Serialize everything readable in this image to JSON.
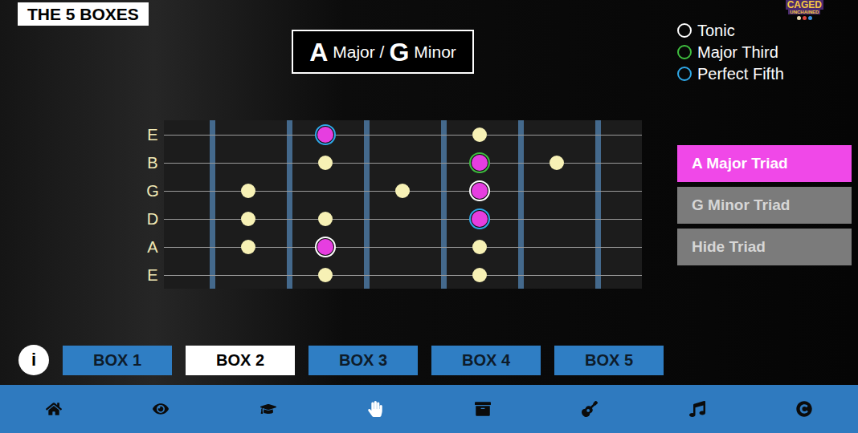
{
  "header": {
    "title": "THE 5 BOXES"
  },
  "logo": {
    "lines": [
      "CAGED",
      "UNCHAINED"
    ],
    "dots": [
      {
        "color": "#e8d9b0"
      },
      {
        "color": "#d9443f"
      },
      {
        "color": "#3d8fe0"
      }
    ]
  },
  "key_title": [
    {
      "text": "A",
      "big": true
    },
    {
      "text": "Major /",
      "big": false
    },
    {
      "text": "G",
      "big": true
    },
    {
      "text": "Minor",
      "big": false
    }
  ],
  "legend": [
    {
      "label": "Tonic",
      "interval": "tonic",
      "color": "#ffffff"
    },
    {
      "label": "Major Third",
      "interval": "third",
      "color": "#3fbf3f"
    },
    {
      "label": "Perfect Fifth",
      "interval": "fifth",
      "color": "#2fa8e8"
    }
  ],
  "fretboard": {
    "strings": [
      {
        "label": "E",
        "dots": [
          {
            "position": 1,
            "in_triad": true,
            "interval": "fifth"
          },
          {
            "position": 3,
            "in_triad": false,
            "interval": "none"
          }
        ]
      },
      {
        "label": "B",
        "dots": [
          {
            "position": 1,
            "in_triad": false,
            "interval": "none"
          },
          {
            "position": 3,
            "in_triad": true,
            "interval": "third"
          },
          {
            "position": 4,
            "in_triad": false,
            "interval": "none"
          }
        ]
      },
      {
        "label": "G",
        "dots": [
          {
            "position": 0,
            "in_triad": false,
            "interval": "none"
          },
          {
            "position": 2,
            "in_triad": false,
            "interval": "none"
          },
          {
            "position": 3,
            "in_triad": true,
            "interval": "tonic"
          }
        ]
      },
      {
        "label": "D",
        "dots": [
          {
            "position": 0,
            "in_triad": false,
            "interval": "none"
          },
          {
            "position": 1,
            "in_triad": false,
            "interval": "none"
          },
          {
            "position": 3,
            "in_triad": true,
            "interval": "fifth"
          }
        ]
      },
      {
        "label": "A",
        "dots": [
          {
            "position": 0,
            "in_triad": false,
            "interval": "none"
          },
          {
            "position": 1,
            "in_triad": true,
            "interval": "tonic"
          },
          {
            "position": 3,
            "in_triad": false,
            "interval": "none"
          }
        ]
      },
      {
        "label": "E",
        "dots": [
          {
            "position": 1,
            "in_triad": false,
            "interval": "none"
          },
          {
            "position": 3,
            "in_triad": false,
            "interval": "none"
          }
        ]
      }
    ]
  },
  "triad_buttons": [
    {
      "label": "A Major Triad",
      "selected": true
    },
    {
      "label": "G Minor Triad",
      "selected": false
    },
    {
      "label": "Hide Triad",
      "selected": false
    }
  ],
  "info": "i",
  "boxes": [
    {
      "label": "BOX 1",
      "selected": false
    },
    {
      "label": "BOX 2",
      "selected": true
    },
    {
      "label": "BOX 3",
      "selected": false
    },
    {
      "label": "BOX 4",
      "selected": false
    },
    {
      "label": "BOX 5",
      "selected": false
    }
  ],
  "nav": [
    {
      "selected": false
    },
    {
      "selected": false
    },
    {
      "selected": false
    },
    {
      "selected": true
    },
    {
      "selected": false
    },
    {
      "selected": false
    },
    {
      "selected": false
    },
    {
      "selected": false
    }
  ]
}
